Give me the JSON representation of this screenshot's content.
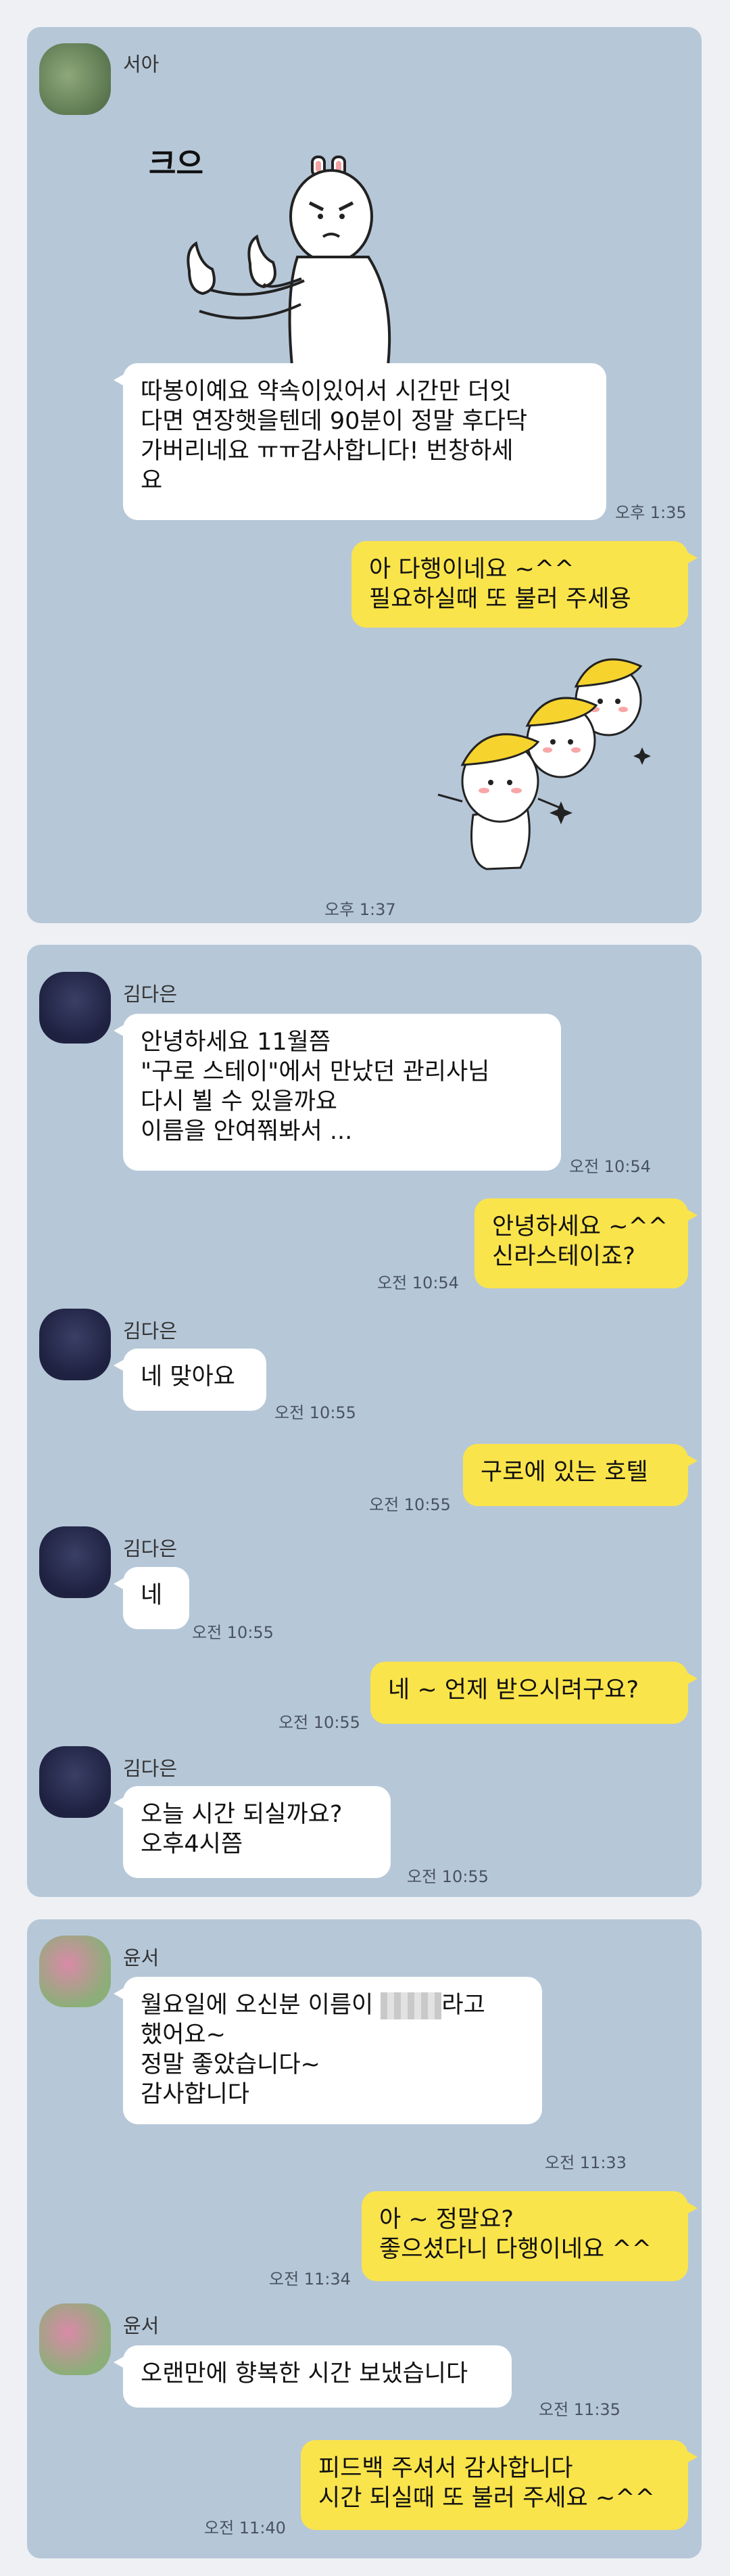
{
  "chat1": {
    "sender": "서아",
    "sticker_text": "크으",
    "in_text": "따봉이예요 약속이있어서 시간만 더잇\n다면 연장햇을텐데 90분이 정말 후다닥\n가버리네요 ㅠㅠ감사합니다! 번창하세\n요",
    "in_time": "오후 1:35",
    "out_text": "아 다행이네요 ~^^\n필요하실때 또 불러 주세용",
    "out_time": "오후 1:37"
  },
  "chat2": {
    "sender": "김다은",
    "msgs": [
      {
        "text": "안녕하세요 11월쯤\n\"구로 스테이\"에서 만났던 관리사님\n다시 뵐 수 있을까요\n이름을 안여쭤봐서 ...",
        "time": "오전 10:54"
      },
      {
        "text": "안녕하세요 ~^^\n신라스테이죠?",
        "time": "오전 10:54"
      },
      {
        "text": "네 맞아요",
        "time": "오전 10:55"
      },
      {
        "text": "구로에 있는 호텔",
        "time": "오전 10:55"
      },
      {
        "text": "네",
        "time": "오전 10:55"
      },
      {
        "text": "네 ~ 언제 받으시려구요?",
        "time": "오전 10:55"
      },
      {
        "text": "오늘  시간 되실까요?\n오후4시쯤",
        "time": "오전 10:55"
      }
    ]
  },
  "chat3": {
    "sender": "윤서",
    "msgs": [
      {
        "before": "월요일에 오신분 이름이 ",
        "after": "라고",
        "rest": "했어요~\n정말 좋았습니다~\n감사합니다",
        "time": "오전 11:33"
      },
      {
        "text": "아 ~ 정말요?\n좋으셨다니 다행이네요 ^^",
        "time": "오전 11:34"
      },
      {
        "text": "오랜만에 향복한 시간 보냈습니다",
        "time": "오전 11:35"
      },
      {
        "text": "피드백 주셔서 감사합니다\n시간 되실때 또 불러 주세요 ~^^",
        "time": "오전 11:40"
      }
    ]
  },
  "colors": {
    "card_bg": "#b6c7d8",
    "incoming_bubble": "#ffffff",
    "outgoing_bubble": "#fae44b",
    "page_bg": "#eef0f3"
  }
}
